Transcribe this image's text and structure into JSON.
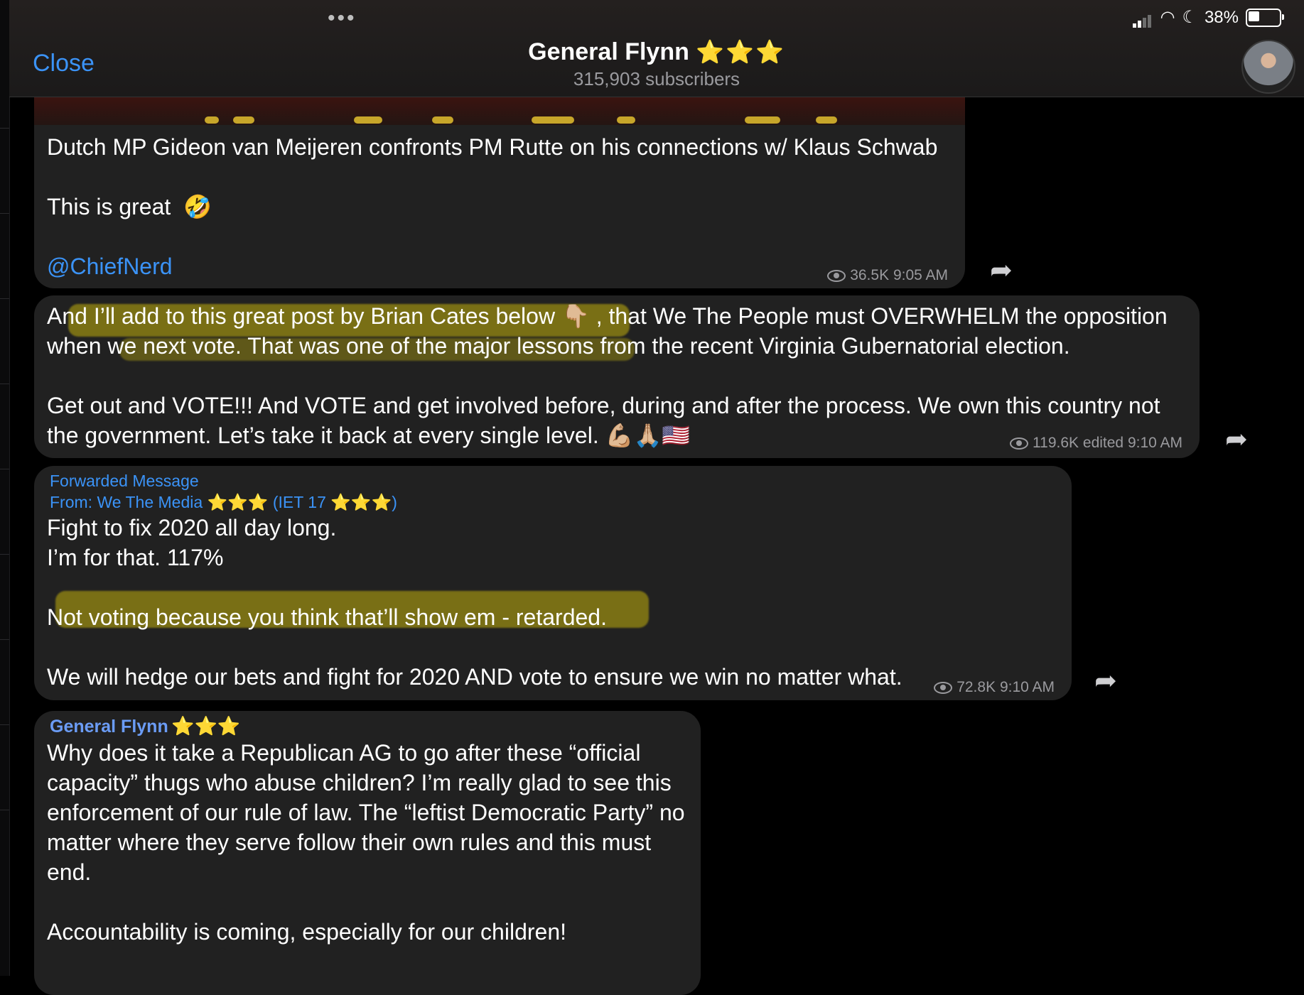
{
  "header": {
    "close_label": "Close",
    "channel_name": "General Flynn",
    "channel_stars": "⭐⭐⭐",
    "subscribers": "315,903 subscribers",
    "dots": "•••"
  },
  "status_bar": {
    "battery": "38%"
  },
  "messages": [
    {
      "text": "Dutch MP Gideon van Meijeren confronts PM Rutte on his connections w/ Klaus Schwab\n\nThis is great  🤣\n\n",
      "link": "@ChiefNerd",
      "views": "36.5K",
      "time": "9:05 AM"
    },
    {
      "text": "And I’ll add to this great post by Brian Cates below 👇🏼 , that We The People must OVERWHELM the opposition when we next vote. That was one of the major lessons from the recent Virginia Gubernatorial election.\n\nGet out and VOTE!!! And VOTE and get involved before, during and after the process. We own this country not the government. Let’s take it back at every single level. 💪🏼🙏🏼🇺🇸",
      "views": "119.6K",
      "time": "edited 9:10 AM"
    },
    {
      "forwarded_label": "Forwarded Message",
      "from_prefix": "From: We The Media",
      "from_stars": "⭐⭐⭐",
      "from_suffix_a": "(IET 17",
      "from_suffix_b": ")",
      "text": "Fight to fix 2020 all day long.\nI’m for that. 117%\n\nNot voting because you think that’ll show em - retarded.\n\nWe will hedge our bets and fight for 2020 AND vote to ensure we win no matter what.",
      "views": "72.8K",
      "time": "9:10 AM"
    },
    {
      "sender": "General Flynn",
      "sender_stars": "⭐⭐⭐",
      "text": "Why does it take a Republican AG to go after these “official capacity” thugs who abuse children? I’m really glad to see this enforcement of our rule of law. The “leftist Democratic Party” no matter where they serve follow their own rules and this must end.\n\nAccountability is coming, especially for our children!"
    }
  ],
  "icons": {
    "share": "share-arrow-icon",
    "views": "eye-icon"
  },
  "colors": {
    "accent": "#3b93f7",
    "bubble": "#212121",
    "highlight": "#b0a00e"
  }
}
